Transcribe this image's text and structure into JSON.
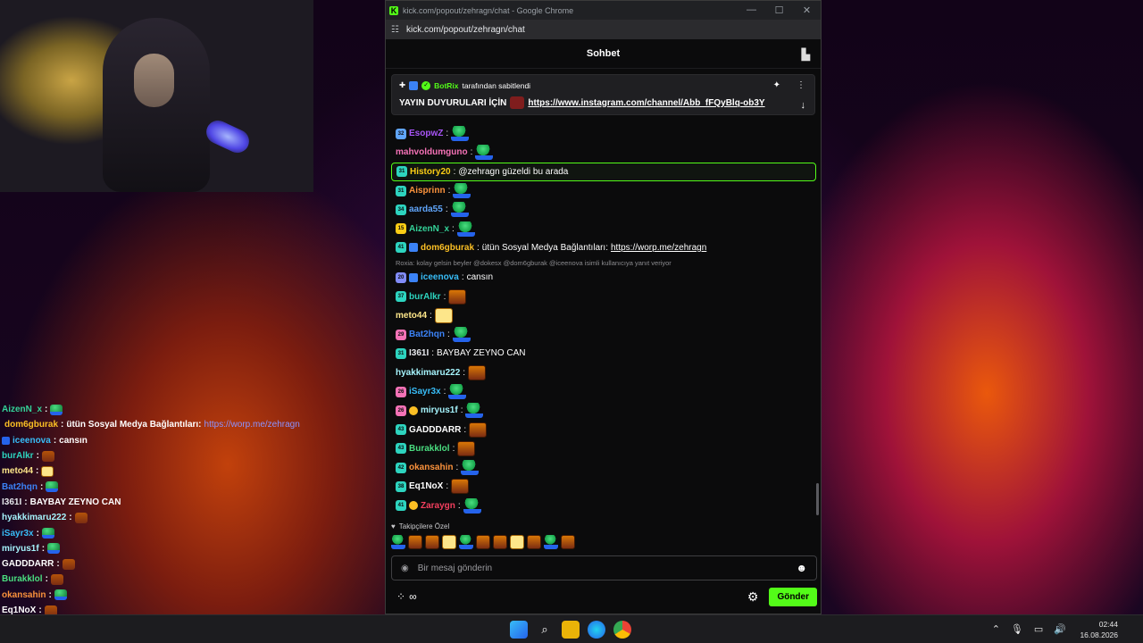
{
  "window": {
    "title": "kick.com/popout/zehragn/chat - Google Chrome",
    "url": "kick.com/popout/zehragn/chat",
    "controls": [
      "—",
      "☐",
      "✕"
    ]
  },
  "chat": {
    "header_title": "Sohbet",
    "pinned": {
      "bot_name": "BotRix",
      "pinned_by_text": "tarafından sabitlendi",
      "message_prefix": "YAYIN DUYURULARI İÇİN",
      "link": "https://www.instagram.com/channel/Abb_fFQyBlq-ob3Y"
    },
    "messages": [
      {
        "badge": "32",
        "badge_color": "#60a5fa",
        "user": "EsopwZ",
        "color": "#a855f7",
        "text": "",
        "emote": "pepe"
      },
      {
        "badge": "",
        "user": "mahvoldumguno",
        "color": "#f472b6",
        "text": "",
        "emote": "pepe"
      },
      {
        "badge": "31",
        "badge_color": "#2dd4bf",
        "user": "History20",
        "color": "#facc15",
        "text": "@zehragn güzeldi bu arada",
        "highlight": true
      },
      {
        "badge": "31",
        "badge_color": "#2dd4bf",
        "user": "Aisprinn",
        "color": "#fb923c",
        "text": "",
        "emote": "pepe"
      },
      {
        "badge": "34",
        "badge_color": "#2dd4bf",
        "user": "aarda55",
        "color": "#60a5fa",
        "text": "",
        "emote": "pepe"
      },
      {
        "badge": "15",
        "badge_color": "#facc15",
        "user": "AizenN_x",
        "color": "#34d399",
        "text": "",
        "emote": "pepe"
      },
      {
        "badge": "41",
        "badge_color": "#2dd4bf",
        "user": "dom6gburak",
        "color": "#fbbf24",
        "text": "ütün Sosyal Medya Bağlantıları: ",
        "link": "https://worp.me/zehragn",
        "mod": true
      },
      {
        "reply": "Roxia: kolay gelsin beyler @dokesx @dom6gburak @iceenova isimli kullanıcıya yanıt veriyor"
      },
      {
        "badge": "20",
        "badge_color": "#818cf8",
        "user": "iceenova",
        "color": "#38bdf8",
        "text": "cansın",
        "mod": true
      },
      {
        "badge": "37",
        "badge_color": "#2dd4bf",
        "user": "burAlkr",
        "color": "#2dd4bf",
        "text": "",
        "emote": "face"
      },
      {
        "badge": "",
        "user": "meto44",
        "color": "#fde68a",
        "text": "",
        "emote": "doge"
      },
      {
        "badge": "29",
        "badge_color": "#f472b6",
        "user": "Bat2hqn",
        "color": "#3b82f6",
        "text": "",
        "emote": "pepe"
      },
      {
        "badge": "31",
        "badge_color": "#2dd4bf",
        "user": "I361I",
        "color": "#e5e7eb",
        "text": "BAYBAY ZEYNO CAN"
      },
      {
        "badge": "",
        "user": "hyakkimaru222",
        "color": "#a5f3fc",
        "text": "",
        "emote": "face"
      },
      {
        "badge": "26",
        "badge_color": "#f472b6",
        "user": "iSayr3x",
        "color": "#38bdf8",
        "text": "",
        "emote": "pepe"
      },
      {
        "badge": "26",
        "badge_color": "#f472b6",
        "user": "miryus1f",
        "color": "#a5f3fc",
        "text": "",
        "emote": "pepe",
        "extra_badge": true
      },
      {
        "badge": "43",
        "badge_color": "#2dd4bf",
        "user": "GADDDARR",
        "color": "#ffffff",
        "text": "",
        "emote": "face"
      },
      {
        "badge": "43",
        "badge_color": "#2dd4bf",
        "user": "Burakklol",
        "color": "#4ade80",
        "text": "",
        "emote": "face"
      },
      {
        "badge": "42",
        "badge_color": "#2dd4bf",
        "user": "okansahin",
        "color": "#fb923c",
        "text": "",
        "emote": "pepe"
      },
      {
        "badge": "38",
        "badge_color": "#2dd4bf",
        "user": "Eq1NoX",
        "color": "#ffffff",
        "text": "",
        "emote": "face"
      },
      {
        "badge": "41",
        "badge_color": "#2dd4bf",
        "user": "Zaraygn",
        "color": "#f43f5e",
        "text": "",
        "emote": "pepe",
        "extra_badge": true
      }
    ],
    "followers_label": "Takipçilere Özel",
    "input_placeholder": "Bir mesaj gönderin",
    "send_label": "Gönder",
    "infinity": "∞"
  },
  "overlay": [
    {
      "user": "AizenN_x",
      "color": "#34d399",
      "emote": "pepe"
    },
    {
      "user": "dom6gburak",
      "color": "#fbbf24",
      "text": "ütün Sosyal Medya Bağlantıları: ",
      "link": "https://worp.me/zehragn",
      "mod": true
    },
    {
      "user": "iceenova",
      "color": "#38bdf8",
      "text": "cansın",
      "mod": true
    },
    {
      "user": "burAlkr",
      "color": "#2dd4bf",
      "emote": "face"
    },
    {
      "user": "meto44",
      "color": "#fde68a",
      "emote": "doge"
    },
    {
      "user": "Bat2hqn",
      "color": "#3b82f6",
      "emote": "pepe"
    },
    {
      "user": "I361I",
      "color": "#e5e7eb",
      "text": "BAYBAY ZEYNO CAN"
    },
    {
      "user": "hyakkimaru222",
      "color": "#a5f3fc",
      "emote": "face"
    },
    {
      "user": "iSayr3x",
      "color": "#38bdf8",
      "emote": "pepe"
    },
    {
      "user": "miryus1f",
      "color": "#a5f3fc",
      "emote": "pepe"
    },
    {
      "user": "GADDDARR",
      "color": "#ffffff",
      "emote": "face"
    },
    {
      "user": "Burakklol",
      "color": "#4ade80",
      "emote": "face"
    },
    {
      "user": "okansahin",
      "color": "#fb923c",
      "emote": "pepe"
    },
    {
      "user": "Eq1NoX",
      "color": "#ffffff",
      "emote": "face"
    }
  ],
  "taskbar": {
    "time": "02:44",
    "date": "16.08.2026"
  },
  "colors": {
    "kick_green": "#53fc18",
    "chat_bg": "#0b0b0c",
    "taskbar_bg": "#1c1c1f"
  }
}
